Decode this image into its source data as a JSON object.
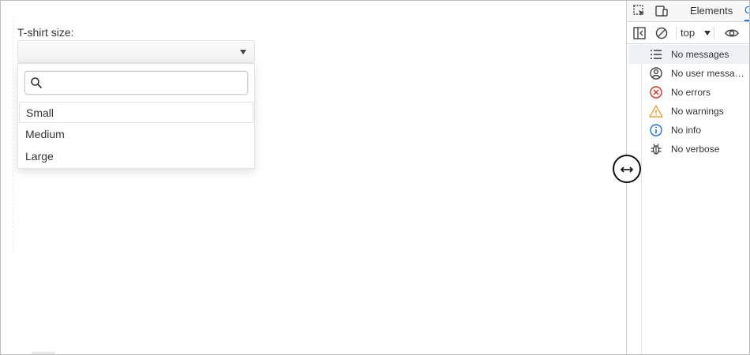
{
  "form": {
    "label": "T-shirt size:",
    "selected_value": "",
    "search_placeholder": "",
    "options": [
      "Small",
      "Medium",
      "Large"
    ]
  },
  "devtools": {
    "tab_elements": "Elements",
    "tab_console_partial": "C",
    "context": "top",
    "sidebar_items": [
      {
        "label": "No messages",
        "icon": "list-icon"
      },
      {
        "label": "No user messa…",
        "icon": "user-icon"
      },
      {
        "label": "No errors",
        "icon": "error-icon"
      },
      {
        "label": "No warnings",
        "icon": "warning-icon"
      },
      {
        "label": "No info",
        "icon": "info-icon"
      },
      {
        "label": "No verbose",
        "icon": "bug-icon"
      }
    ]
  },
  "colors": {
    "error": "#d93025",
    "warning": "#e8a33d",
    "info": "#1a73e8",
    "accent": "#1a73e8"
  }
}
